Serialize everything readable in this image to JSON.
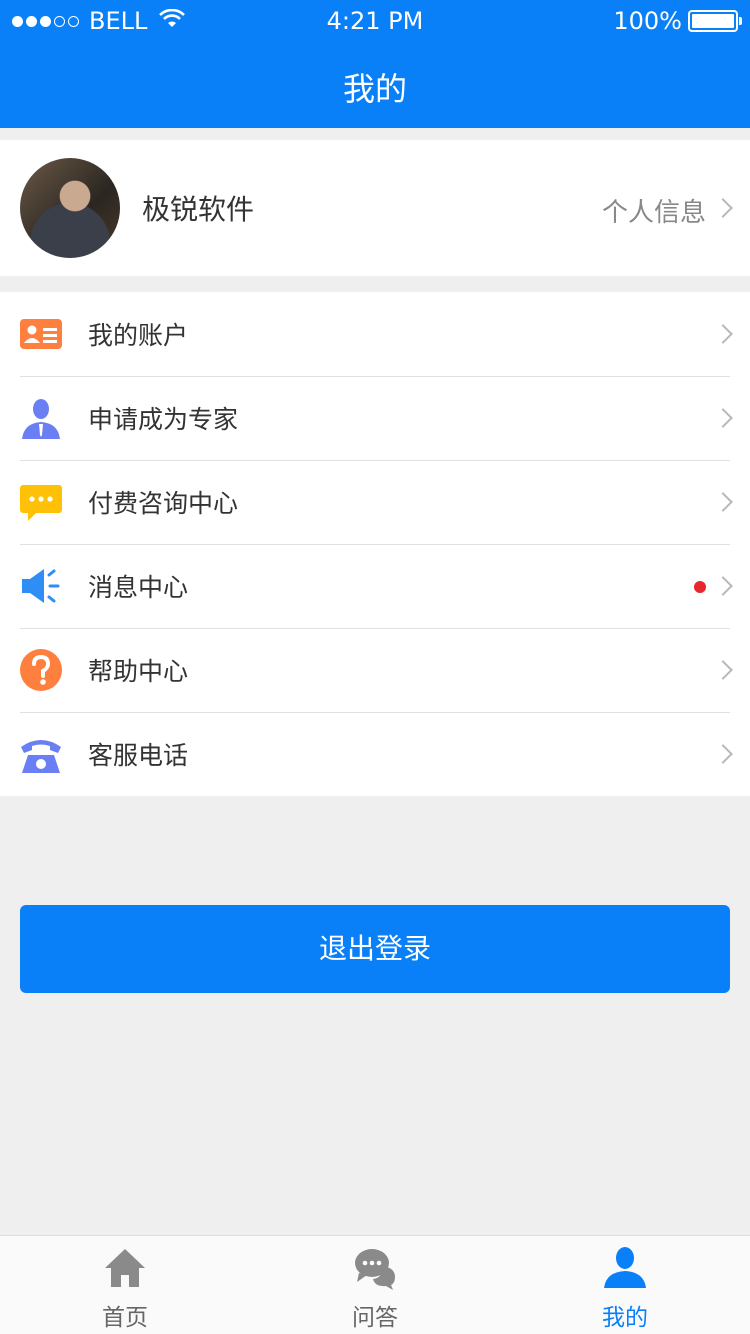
{
  "status_bar": {
    "carrier": "BELL",
    "time": "4:21 PM",
    "battery": "100%"
  },
  "header": {
    "title": "我的"
  },
  "profile": {
    "name": "极锐软件",
    "info_label": "个人信息"
  },
  "menu": {
    "items": [
      {
        "label": "我的账户",
        "icon": "id-card-icon",
        "color": "#ff7f3f"
      },
      {
        "label": "申请成为专家",
        "icon": "expert-person-icon",
        "color": "#6b7ff5"
      },
      {
        "label": "付费咨询中心",
        "icon": "chat-bubble-icon",
        "color": "#ffc107"
      },
      {
        "label": "消息中心",
        "icon": "speaker-icon",
        "color": "#2f8ef6",
        "badge": "red-dot"
      },
      {
        "label": "帮助中心",
        "icon": "question-circle-icon",
        "color": "#ff7f3f"
      },
      {
        "label": "客服电话",
        "icon": "telephone-icon",
        "color": "#6b7ff5"
      }
    ]
  },
  "logout": {
    "label": "退出登录"
  },
  "tabbar": {
    "tabs": [
      {
        "label": "首页",
        "icon": "home-icon",
        "active": false
      },
      {
        "label": "问答",
        "icon": "chat-bubbles-icon",
        "active": false
      },
      {
        "label": "我的",
        "icon": "user-icon",
        "active": true
      }
    ]
  },
  "colors": {
    "primary": "#0a80f8",
    "background": "#efefef",
    "badge": "#e8262b"
  }
}
